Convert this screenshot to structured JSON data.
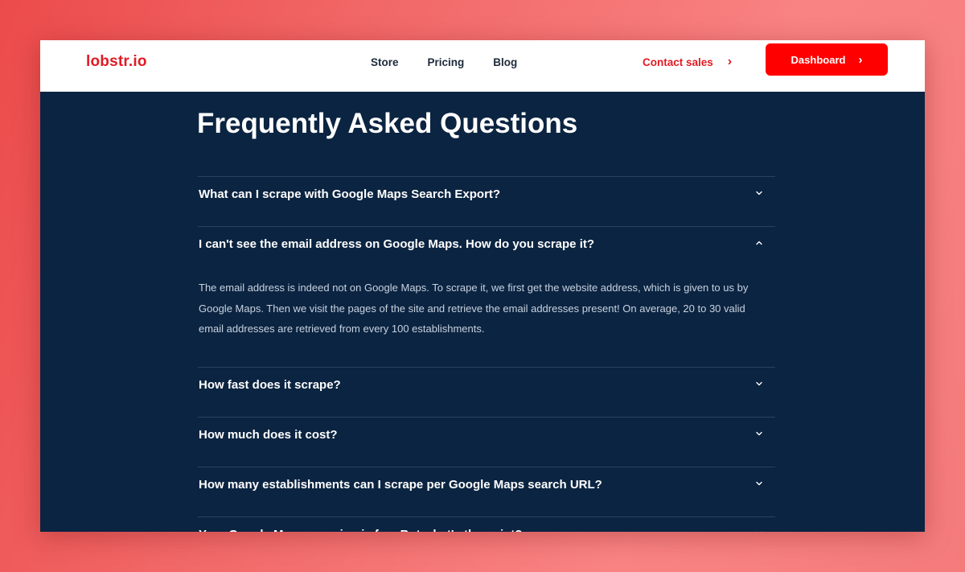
{
  "header": {
    "logo": "lobstr.io",
    "nav": [
      "Store",
      "Pricing",
      "Blog"
    ],
    "contact_label": "Contact sales",
    "dashboard_label": "Dashboard",
    "brand_color": "#e01b24"
  },
  "faq": {
    "title": "Frequently Asked Questions",
    "items": [
      {
        "question": "What can I scrape with Google Maps Search Export?",
        "expanded": false
      },
      {
        "question": "I can't see the email address on Google Maps. How do you scrape it?",
        "expanded": true,
        "answer": "The email address is indeed not on Google Maps. To scrape it, we first get the website address, which is given to us by Google Maps. Then we visit the pages of the site and retrieve the email addresses present! On average, 20 to 30 valid email addresses are retrieved from every 100 establishments."
      },
      {
        "question": "How fast does it scrape?",
        "expanded": false
      },
      {
        "question": "How much does it cost?",
        "expanded": false
      },
      {
        "question": "How many establishments can I scrape per Google Maps search URL?",
        "expanded": false
      },
      {
        "question": "Your Google Maps scraping is fun. But what's the point?",
        "expanded": false
      }
    ]
  },
  "colors": {
    "page_background": "#0b2441",
    "dashboard_button": "#ff0000"
  }
}
